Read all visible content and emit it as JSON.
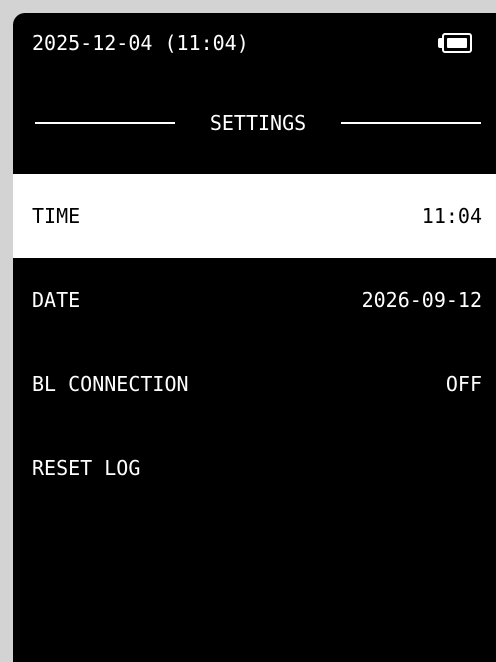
{
  "status_bar": {
    "datetime": "2025-12-04 (11:04)",
    "battery_icon": "battery-full-icon"
  },
  "screen": {
    "title": "SETTINGS"
  },
  "menu": {
    "items": [
      {
        "label": "TIME",
        "value": "11:04",
        "selected": true
      },
      {
        "label": "DATE",
        "value": "2026-09-12",
        "selected": false
      },
      {
        "label": "BL CONNECTION",
        "value": "OFF",
        "selected": false
      },
      {
        "label": "RESET LOG",
        "value": "",
        "selected": false
      }
    ]
  },
  "colors": {
    "background": "#000000",
    "foreground": "#ffffff",
    "selected_background": "#ffffff",
    "selected_foreground": "#000000",
    "bezel": "#d3d3d3"
  }
}
